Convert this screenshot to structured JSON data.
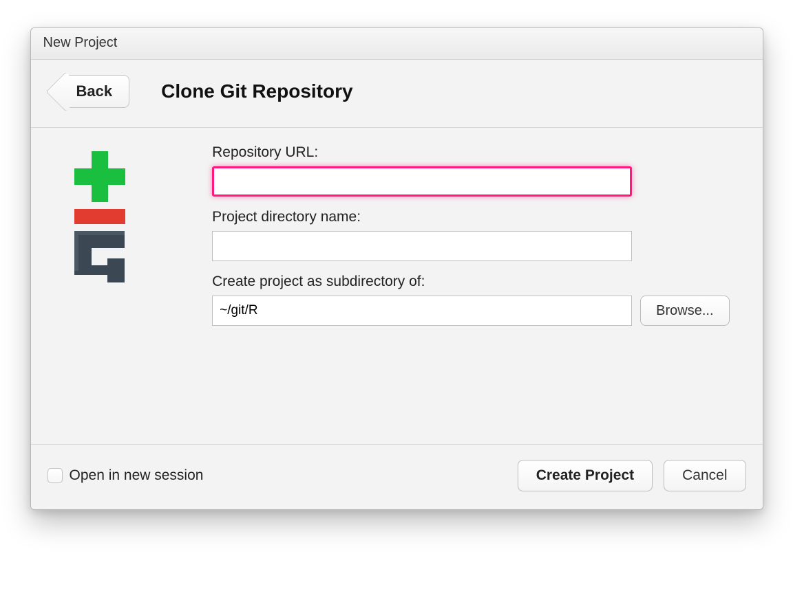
{
  "window": {
    "title": "New Project"
  },
  "header": {
    "back_label": "Back",
    "page_title": "Clone Git Repository"
  },
  "form": {
    "repo_url_label": "Repository URL:",
    "repo_url_value": "",
    "project_dir_label": "Project directory name:",
    "project_dir_value": "",
    "subdir_label": "Create project as subdirectory of:",
    "subdir_value": "~/git/R",
    "browse_label": "Browse..."
  },
  "footer": {
    "open_new_session_label": "Open in new session",
    "open_new_session_checked": false,
    "create_label": "Create Project",
    "cancel_label": "Cancel"
  },
  "icons": {
    "git": "git-icon"
  }
}
